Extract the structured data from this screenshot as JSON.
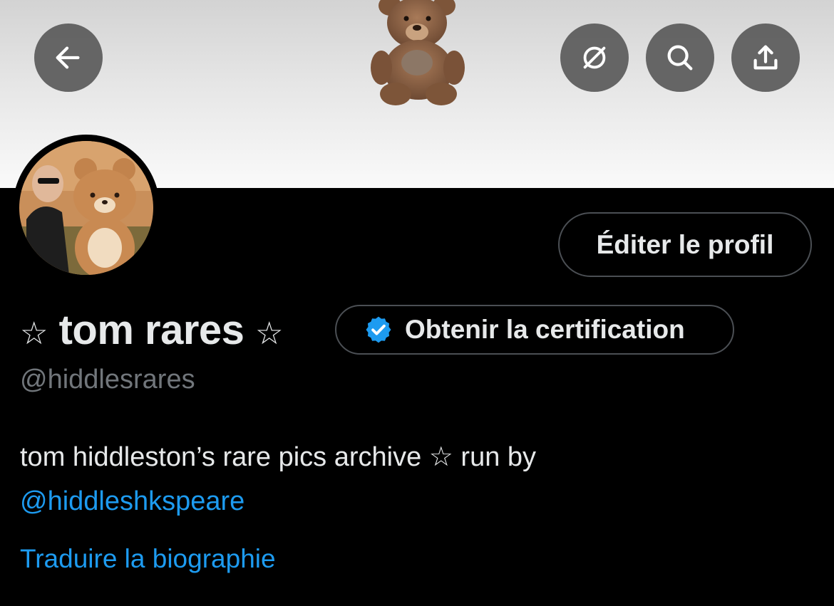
{
  "header": {
    "back_icon": "arrow-left-icon",
    "actions": [
      "hide-broken-circle-icon",
      "search-icon",
      "share-upload-icon"
    ]
  },
  "profile": {
    "edit_button": "Éditer le profil",
    "name_star": "☆",
    "display_name": "tom rares",
    "certification_button": "Obtenir la certification",
    "handle": "@hiddlesrares",
    "bio_text": "tom hiddleston’s rare pics archive ☆ run by",
    "bio_mention": "@hiddleshkspeare",
    "translate_link": "Traduire la biographie"
  },
  "colors": {
    "accent": "#1d9bf0",
    "background": "#000000",
    "text_primary": "#e7e9ea",
    "text_secondary": "#71767b",
    "border": "#4b4f54"
  }
}
